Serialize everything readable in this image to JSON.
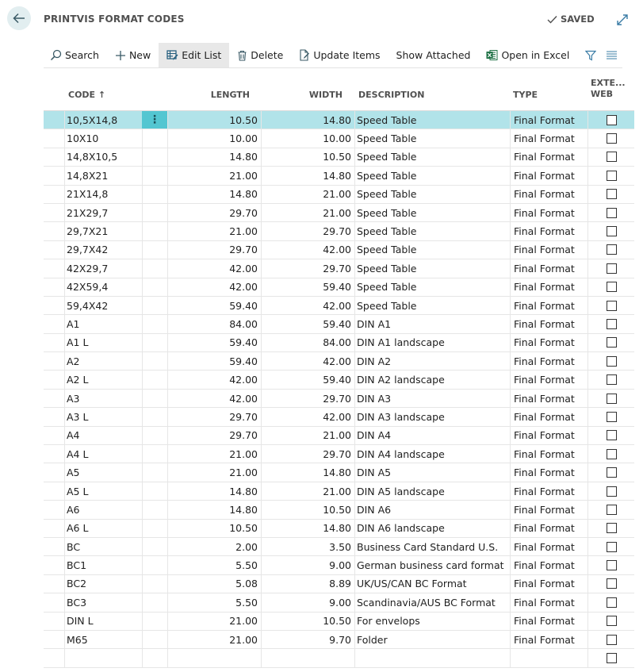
{
  "header": {
    "title": "PRINTVIS FORMAT CODES",
    "saved_label": "SAVED"
  },
  "toolbar": {
    "search": "Search",
    "new": "New",
    "edit_list": "Edit List",
    "delete": "Delete",
    "update_items": "Update Items",
    "show_attached": "Show Attached",
    "open_in_excel": "Open in Excel"
  },
  "columns": {
    "code": "CODE",
    "code_sort": "↑",
    "length": "LENGTH",
    "width": "WIDTH",
    "description": "DESCRIPTION",
    "type": "TYPE",
    "ext_web_1": "EXTE...",
    "ext_web_2": "WEB"
  },
  "rows": [
    {
      "code": "10,5X14,8",
      "length": "10.50",
      "width": "14.80",
      "description": "Speed Table",
      "type": "Final Format"
    },
    {
      "code": "10X10",
      "length": "10.00",
      "width": "10.00",
      "description": "Speed Table",
      "type": "Final Format"
    },
    {
      "code": "14,8X10,5",
      "length": "14.80",
      "width": "10.50",
      "description": "Speed Table",
      "type": "Final Format"
    },
    {
      "code": "14,8X21",
      "length": "21.00",
      "width": "14.80",
      "description": "Speed Table",
      "type": "Final Format"
    },
    {
      "code": "21X14,8",
      "length": "14.80",
      "width": "21.00",
      "description": "Speed Table",
      "type": "Final Format"
    },
    {
      "code": "21X29,7",
      "length": "29.70",
      "width": "21.00",
      "description": "Speed Table",
      "type": "Final Format"
    },
    {
      "code": "29,7X21",
      "length": "21.00",
      "width": "29.70",
      "description": "Speed Table",
      "type": "Final Format"
    },
    {
      "code": "29,7X42",
      "length": "29.70",
      "width": "42.00",
      "description": "Speed Table",
      "type": "Final Format"
    },
    {
      "code": "42X29,7",
      "length": "42.00",
      "width": "29.70",
      "description": "Speed Table",
      "type": "Final Format"
    },
    {
      "code": "42X59,4",
      "length": "42.00",
      "width": "59.40",
      "description": "Speed Table",
      "type": "Final Format"
    },
    {
      "code": "59,4X42",
      "length": "59.40",
      "width": "42.00",
      "description": "Speed Table",
      "type": "Final Format"
    },
    {
      "code": "A1",
      "length": "84.00",
      "width": "59.40",
      "description": "DIN A1",
      "type": "Final Format"
    },
    {
      "code": "A1 L",
      "length": "59.40",
      "width": "84.00",
      "description": "DIN A1 landscape",
      "type": "Final Format"
    },
    {
      "code": "A2",
      "length": "59.40",
      "width": "42.00",
      "description": "DIN A2",
      "type": "Final Format"
    },
    {
      "code": "A2 L",
      "length": "42.00",
      "width": "59.40",
      "description": "DIN A2 landscape",
      "type": "Final Format"
    },
    {
      "code": "A3",
      "length": "42.00",
      "width": "29.70",
      "description": "DIN A3",
      "type": "Final Format"
    },
    {
      "code": "A3 L",
      "length": "29.70",
      "width": "42.00",
      "description": "DIN A3 landscape",
      "type": "Final Format"
    },
    {
      "code": "A4",
      "length": "29.70",
      "width": "21.00",
      "description": "DIN A4",
      "type": "Final Format"
    },
    {
      "code": "A4 L",
      "length": "21.00",
      "width": "29.70",
      "description": "DIN A4 landscape",
      "type": "Final Format"
    },
    {
      "code": "A5",
      "length": "21.00",
      "width": "14.80",
      "description": "DIN A5",
      "type": "Final Format"
    },
    {
      "code": "A5 L",
      "length": "14.80",
      "width": "21.00",
      "description": "DIN A5 landscape",
      "type": "Final Format"
    },
    {
      "code": "A6",
      "length": "14.80",
      "width": "10.50",
      "description": "DIN A6",
      "type": "Final Format"
    },
    {
      "code": "A6 L",
      "length": "10.50",
      "width": "14.80",
      "description": "DIN A6 landscape",
      "type": "Final Format"
    },
    {
      "code": "BC",
      "length": "2.00",
      "width": "3.50",
      "description": "Business Card Standard U.S.",
      "type": "Final Format"
    },
    {
      "code": "BC1",
      "length": "5.50",
      "width": "9.00",
      "description": "German business card format",
      "type": "Final Format"
    },
    {
      "code": "BC2",
      "length": "5.08",
      "width": "8.89",
      "description": "UK/US/CAN BC Format",
      "type": "Final Format"
    },
    {
      "code": "BC3",
      "length": "5.50",
      "width": "9.00",
      "description": "Scandinavia/AUS BC Format",
      "type": "Final Format"
    },
    {
      "code": "DIN L",
      "length": "21.00",
      "width": "10.50",
      "description": "For envelops",
      "type": "Final Format"
    },
    {
      "code": "M65",
      "length": "21.00",
      "width": "9.70",
      "description": "Folder",
      "type": "Final Format"
    },
    {
      "code": "",
      "length": "",
      "width": "",
      "description": "",
      "type": ""
    }
  ],
  "icons": {
    "back": "arrow-left-icon",
    "saved": "checkmark-icon",
    "expand": "expand-icon",
    "search": "search-icon",
    "new": "plus-icon",
    "edit_list": "edit-list-icon",
    "delete": "trash-icon",
    "update_items": "document-edit-icon",
    "excel": "excel-icon",
    "filter": "filter-icon",
    "list": "list-icon"
  },
  "colors": {
    "selected_row": "#b1e3e9",
    "selected_marker": "#53c6d1",
    "excel_green": "#1e7145",
    "accent": "#3a7ca5"
  }
}
